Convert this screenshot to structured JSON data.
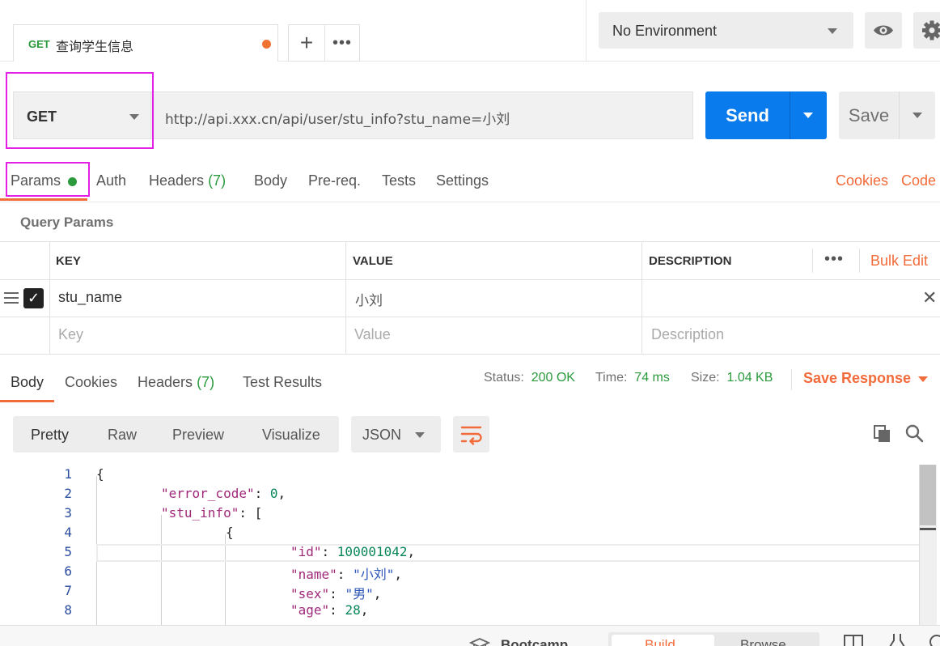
{
  "request_tab": {
    "method": "GET",
    "title": "查询学生信息",
    "unsaved_color": "#f07233"
  },
  "tabs_actions": {
    "add_label": "+",
    "more_label": "•••"
  },
  "environment": {
    "selected": "No Environment"
  },
  "request": {
    "method": "GET",
    "url": "http://api.xxx.cn/api/user/stu_info?stu_name=小刘",
    "send_label": "Send",
    "save_label": "Save"
  },
  "request_tabs": {
    "params": "Params",
    "auth": "Auth",
    "headers": "Headers",
    "headers_count": "(7)",
    "body": "Body",
    "prereq": "Pre-req.",
    "tests": "Tests",
    "settings": "Settings",
    "cookies": "Cookies",
    "code": "Code"
  },
  "query_params": {
    "title": "Query Params",
    "columns": [
      "KEY",
      "VALUE",
      "DESCRIPTION"
    ],
    "bulk_edit": "Bulk Edit",
    "rows": [
      {
        "key": "stu_name",
        "value": "小刘",
        "description": "",
        "enabled": true
      }
    ],
    "placeholders": {
      "key": "Key",
      "value": "Value",
      "description": "Description"
    }
  },
  "response_tabs": {
    "body": "Body",
    "cookies": "Cookies",
    "headers": "Headers",
    "headers_count": "(7)",
    "test_results": "Test Results"
  },
  "response_status": {
    "status_label": "Status:",
    "status_value": "200 OK",
    "time_label": "Time:",
    "time_value": "74 ms",
    "size_label": "Size:",
    "size_value": "1.04 KB",
    "save_response": "Save Response"
  },
  "viewer": {
    "modes": [
      "Pretty",
      "Raw",
      "Preview",
      "Visualize"
    ],
    "format": "JSON"
  },
  "code_lines": [
    {
      "n": "1",
      "text": "{"
    },
    {
      "n": "2",
      "key": "\"error_code\"",
      "sep": ": ",
      "num": "0",
      "tail": ","
    },
    {
      "n": "3",
      "key": "\"stu_info\"",
      "sep": ": ",
      "tail": "["
    },
    {
      "n": "4",
      "text": "{"
    },
    {
      "n": "5",
      "key": "\"id\"",
      "sep": ": ",
      "num": "100001042",
      "tail": ","
    },
    {
      "n": "6",
      "key": "\"name\"",
      "sep": ": ",
      "str": "\"小刘\"",
      "tail": ","
    },
    {
      "n": "7",
      "key": "\"sex\"",
      "sep": ": ",
      "str": "\"男\"",
      "tail": ","
    },
    {
      "n": "8",
      "key": "\"age\"",
      "sep": ": ",
      "num": "28",
      "tail": ","
    }
  ],
  "footer": {
    "bootcamp": "Bootcamp",
    "build": "Build",
    "browse": "Browse"
  },
  "colors": {
    "accent_orange": "#f26b3a",
    "send_blue": "#097bed",
    "success_green": "#2b9a3c",
    "highlight_magenta": "#e520e5"
  }
}
